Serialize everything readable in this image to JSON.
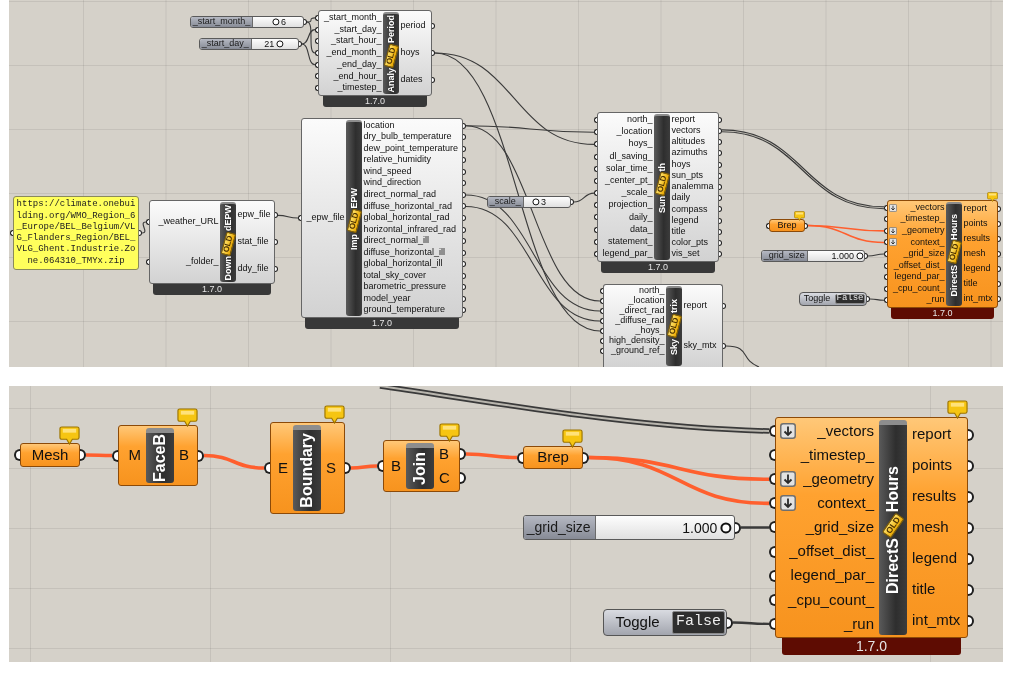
{
  "canvases": [
    {
      "nodes": [
        {
          "kind": "slider",
          "label": "_start_month_",
          "value": "6",
          "level": 0.45,
          "selected": false,
          "remark": false
        },
        {
          "kind": "slider",
          "label": "_start_day_",
          "value": "21",
          "level": 0.6,
          "selected": false,
          "remark": false
        },
        {
          "kind": "component",
          "title_parts": [
            "Analy",
            "Period"
          ],
          "badge": "OLD",
          "inputs": [
            "_start_month_",
            "_start_day_",
            "_start_hour_",
            "_end_month_",
            "_end_day_",
            "_end_hour_",
            "_timestep_"
          ],
          "outputs": [
            "period",
            "hoys",
            "dates"
          ],
          "version": "1.7.0",
          "selected": false,
          "remark": false
        },
        {
          "kind": "panel",
          "text": "https://climate.onebuilding.org/WMO_Region_6_Europe/BEL_Belgium/VLG_Flanders_Region/BEL_VLG_Ghent.Industrie.Zone.064310_TMYx.zip",
          "selected": false,
          "remark": false
        },
        {
          "kind": "component",
          "title_parts": [
            "Down",
            "dEPW"
          ],
          "badge": "OLD",
          "inputs": [
            "_weather_URL",
            "_folder_"
          ],
          "outputs": [
            "epw_file",
            "stat_file",
            "ddy_file"
          ],
          "version": "1.7.0",
          "selected": false,
          "remark": false
        },
        {
          "kind": "component",
          "title_parts": [
            "Imp",
            "EPW"
          ],
          "badge": "OLD",
          "inputs": [
            "_epw_file"
          ],
          "outputs": [
            "location",
            "dry_bulb_temperature",
            "dew_point_temperature",
            "relative_humidity",
            "wind_speed",
            "wind_direction",
            "direct_normal_rad",
            "diffuse_horizontal_rad",
            "global_horizontal_rad",
            "horizontal_infrared_rad",
            "direct_normal_ill",
            "diffuse_horizontal_ill",
            "global_horizontal_ill",
            "total_sky_cover",
            "barometric_pressure",
            "model_year",
            "ground_temperature"
          ],
          "version": "1.7.0",
          "selected": false,
          "remark": false
        },
        {
          "kind": "slider",
          "label": "_scale_",
          "value": "3",
          "level": 0.25,
          "selected": false,
          "remark": false
        },
        {
          "kind": "component",
          "title_parts": [
            "Sun",
            "th"
          ],
          "badge": "OLD",
          "inputs": [
            "north_",
            "_location",
            "hoys_",
            "dl_saving_",
            "solar_time_",
            "_center_pt_",
            "_scale_",
            "projection_",
            "daily_",
            "data_",
            "statement_",
            "legend_par_"
          ],
          "outputs": [
            "report",
            "vectors",
            "altitudes",
            "azimuths",
            "hoys",
            "sun_pts",
            "analemma",
            "daily",
            "compass",
            "legend",
            "title",
            "color_pts",
            "vis_set"
          ],
          "version": "1.7.0",
          "selected": false,
          "remark": false
        },
        {
          "kind": "component",
          "title_parts": [
            "Sky",
            "trix"
          ],
          "badge": "OLD",
          "inputs": [
            "north_",
            "_location",
            "_direct_rad",
            "_diffuse_rad",
            "_hoys_",
            "high_density_",
            "_ground_ref_"
          ],
          "outputs": [
            "report",
            "sky_mtx"
          ],
          "selected": false,
          "remark": false
        },
        {
          "kind": "param",
          "label": "Brep",
          "selected": true,
          "remark": true
        },
        {
          "kind": "slider",
          "label": "_grid_size",
          "value": "1.000",
          "level": 0.92,
          "selected": false,
          "remark": false
        },
        {
          "kind": "toggle",
          "label": "Toggle",
          "value": "False",
          "selected": false,
          "remark": false
        },
        {
          "kind": "component",
          "title_parts": [
            "DirectS",
            "Hours"
          ],
          "badge": "OLD",
          "inputs": [
            {
              "label": "_vectors",
              "flatten": true
            },
            {
              "label": "_timestep_",
              "flatten": false
            },
            {
              "label": "_geometry",
              "flatten": true
            },
            {
              "label": "context_",
              "flatten": true
            },
            {
              "label": "_grid_size",
              "flatten": false
            },
            {
              "label": "_offset_dist_",
              "flatten": false
            },
            {
              "label": "legend_par_",
              "flatten": false
            },
            {
              "label": "_cpu_count_",
              "flatten": false
            },
            {
              "label": "_run",
              "flatten": false
            }
          ],
          "outputs": [
            "report",
            "points",
            "results",
            "mesh",
            "legend",
            "title",
            "int_mtx"
          ],
          "version": "1.7.0",
          "selected": true,
          "remark": true
        }
      ]
    },
    {
      "nodes": [
        {
          "kind": "param",
          "label": "Mesh",
          "selected": true,
          "remark": true
        },
        {
          "kind": "component",
          "title_parts": [
            "FaceB"
          ],
          "inputs": [
            "M"
          ],
          "outputs": [
            "B"
          ],
          "selected": true,
          "remark": true
        },
        {
          "kind": "component",
          "title_parts": [
            "Boundary"
          ],
          "inputs": [
            "E"
          ],
          "outputs": [
            "S"
          ],
          "selected": true,
          "remark": true
        },
        {
          "kind": "component",
          "title_parts": [
            "Join"
          ],
          "inputs": [
            "B"
          ],
          "outputs": [
            "B",
            "C"
          ],
          "selected": true,
          "remark": true
        },
        {
          "kind": "param",
          "label": "Brep",
          "selected": true,
          "remark": true
        },
        {
          "kind": "slider",
          "label": "_grid_size",
          "value": "1.000",
          "level": 0.94,
          "selected": false,
          "remark": false
        },
        {
          "kind": "toggle",
          "label": "Toggle",
          "value": "False",
          "selected": false,
          "remark": false
        },
        {
          "kind": "component",
          "title_parts": [
            "DirectS",
            "Hours"
          ],
          "badge": "OLD",
          "inputs": [
            {
              "label": "_vectors",
              "flatten": true
            },
            {
              "label": "_timestep_",
              "flatten": false
            },
            {
              "label": "_geometry",
              "flatten": true
            },
            {
              "label": "context_",
              "flatten": true
            },
            {
              "label": "_grid_size",
              "flatten": false
            },
            {
              "label": "_offset_dist_",
              "flatten": false
            },
            {
              "label": "legend_par_",
              "flatten": false
            },
            {
              "label": "_cpu_count_",
              "flatten": false
            },
            {
              "label": "_run",
              "flatten": false
            }
          ],
          "outputs": [
            "report",
            "points",
            "results",
            "mesh",
            "legend",
            "title",
            "int_mtx"
          ],
          "version": "1.7.0",
          "selected": true,
          "remark": true
        }
      ]
    }
  ]
}
